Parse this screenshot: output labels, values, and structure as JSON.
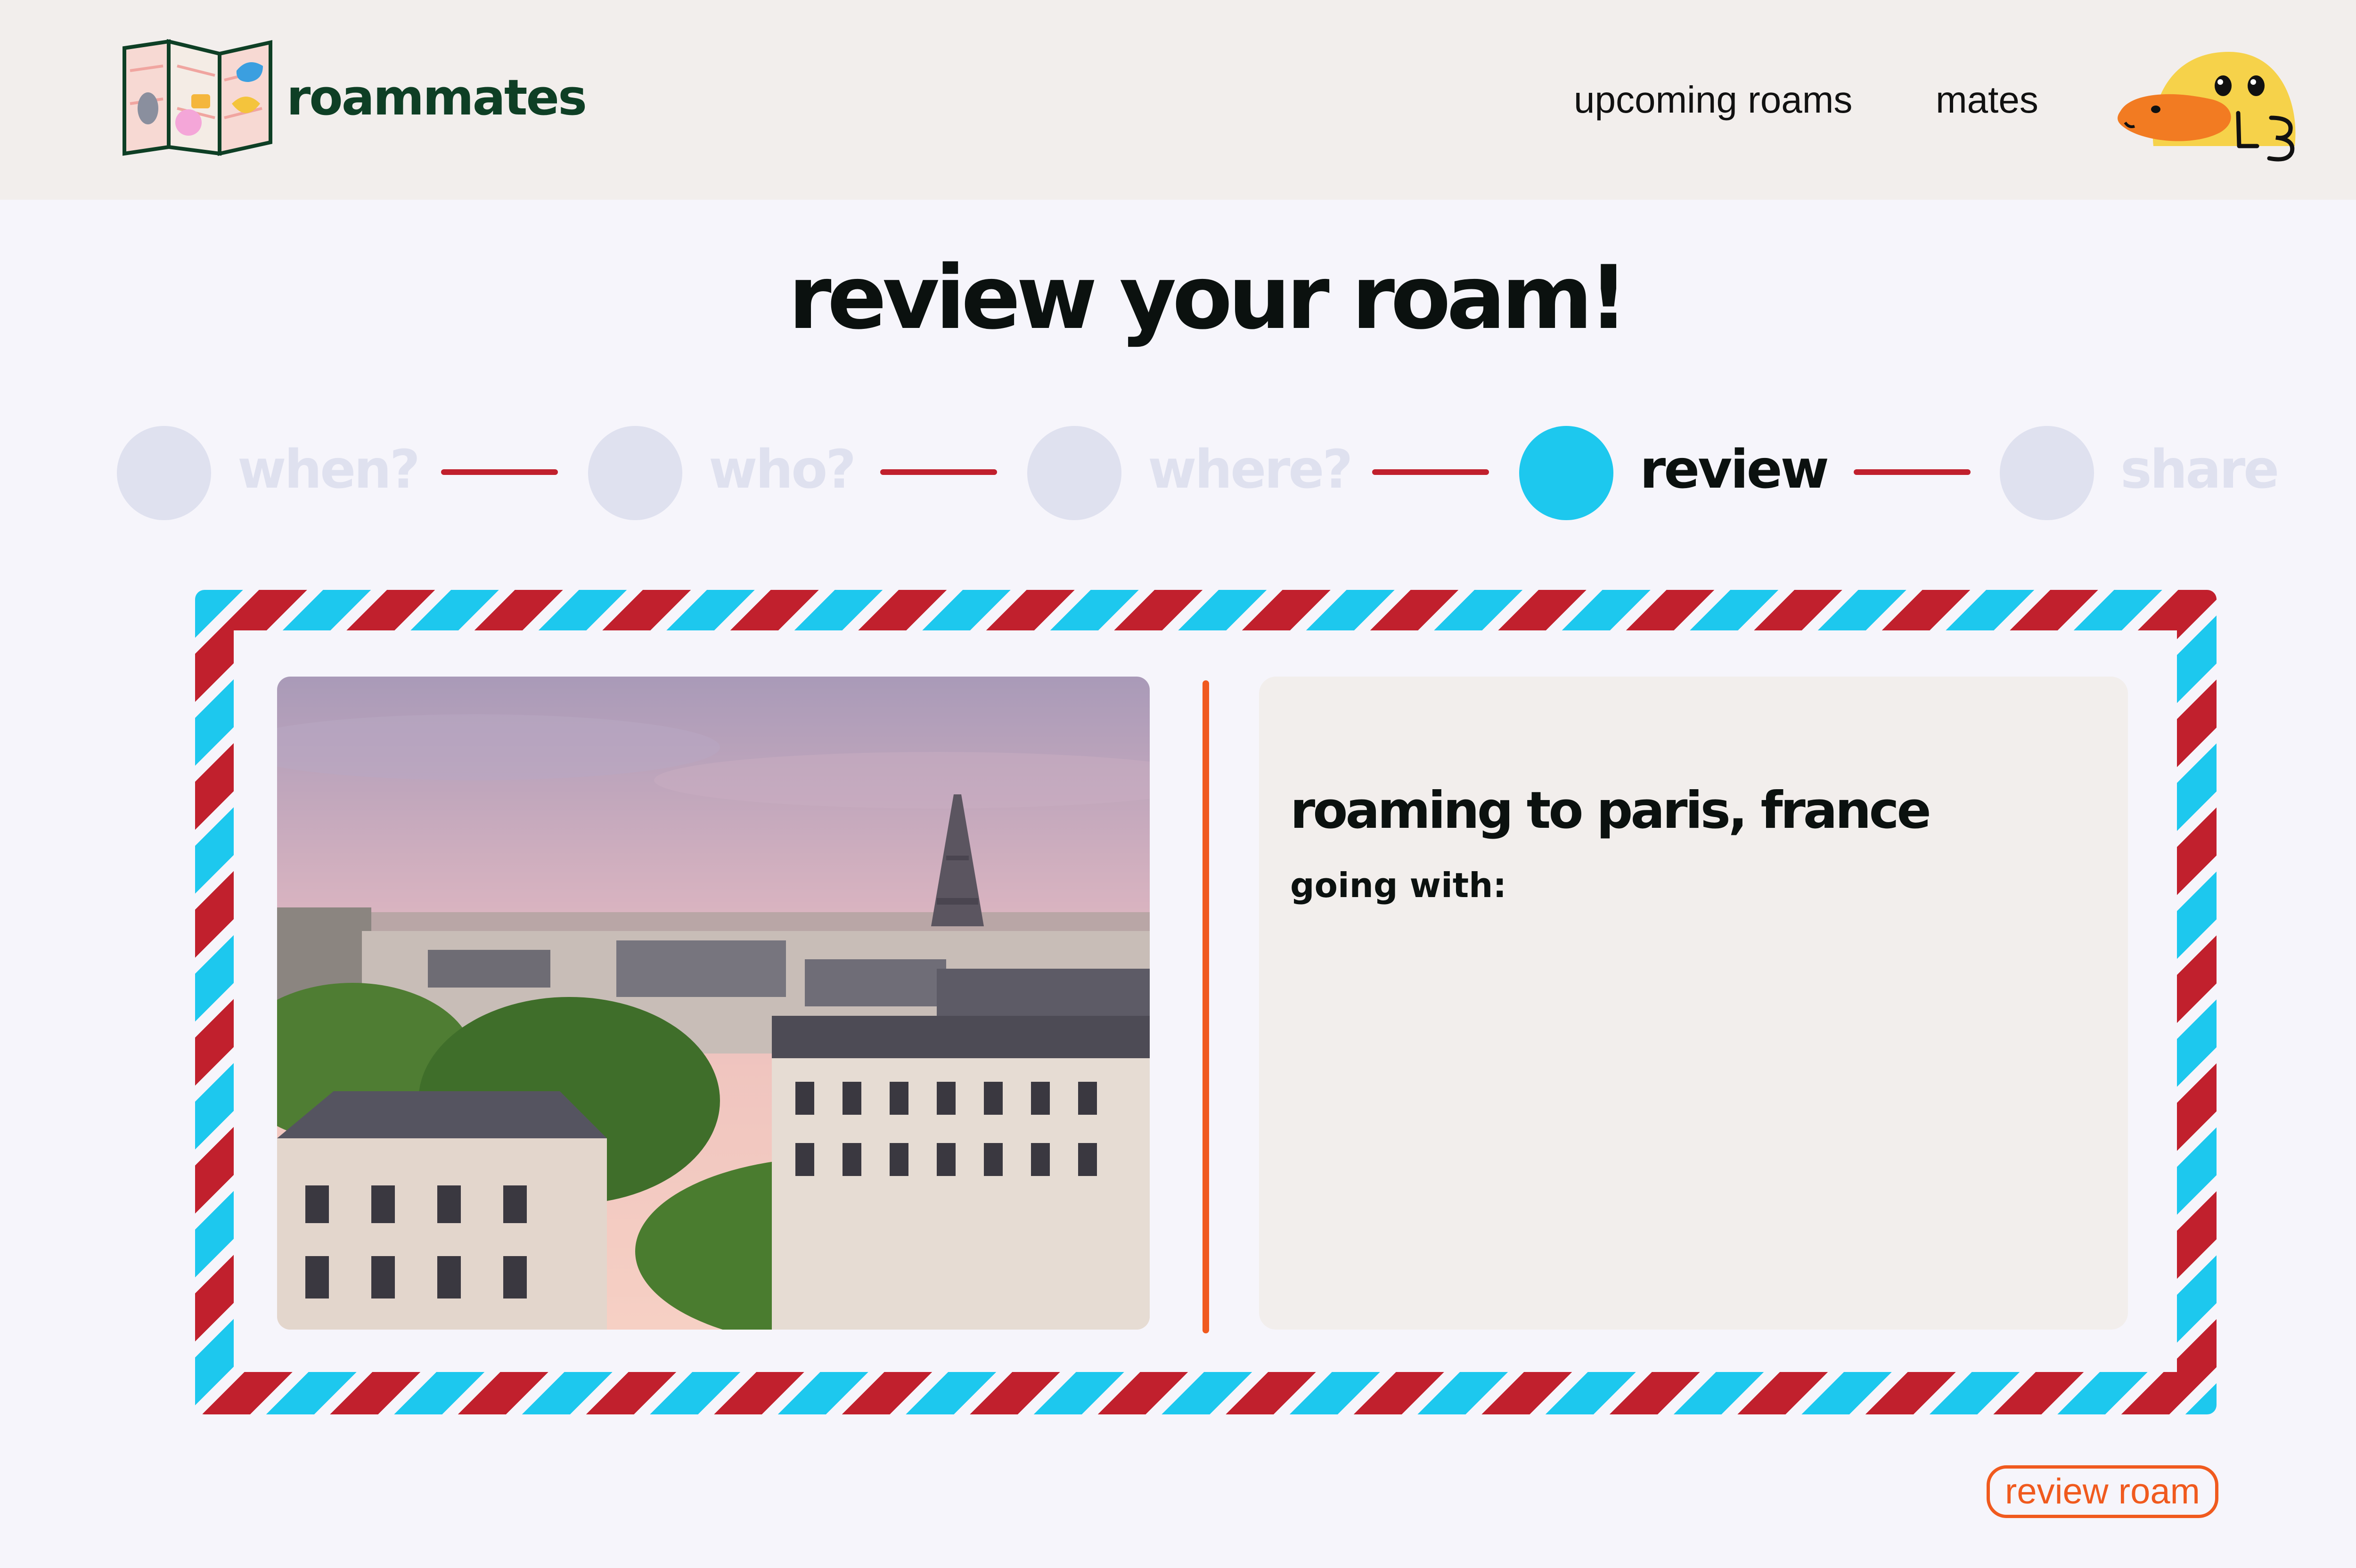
{
  "header": {
    "brand_name": "roammates",
    "nav": [
      {
        "label": "upcoming roams"
      },
      {
        "label": "mates"
      }
    ]
  },
  "page": {
    "title": "review your roam!"
  },
  "stepper": {
    "steps": [
      {
        "label": "when?",
        "state": "inactive"
      },
      {
        "label": "who?",
        "state": "inactive"
      },
      {
        "label": "where?",
        "state": "inactive"
      },
      {
        "label": "review",
        "state": "active"
      },
      {
        "label": "share",
        "state": "inactive"
      }
    ]
  },
  "trip": {
    "title": "roaming to paris, france",
    "going_with_label": "going with:"
  },
  "actions": {
    "review_label": "review roam"
  },
  "colors": {
    "header_bg": "#f2eeec",
    "page_bg": "#f6f5fb",
    "brand_green": "#0e3f25",
    "active_blue": "#1dc8ee",
    "inactive_gray": "#dfe1ef",
    "airmail_red": "#c1202d",
    "accent_orange": "#f05a1e"
  },
  "icons": {
    "logo": "folded-map-logo-icon",
    "avatar": "duck-avatar-icon"
  }
}
